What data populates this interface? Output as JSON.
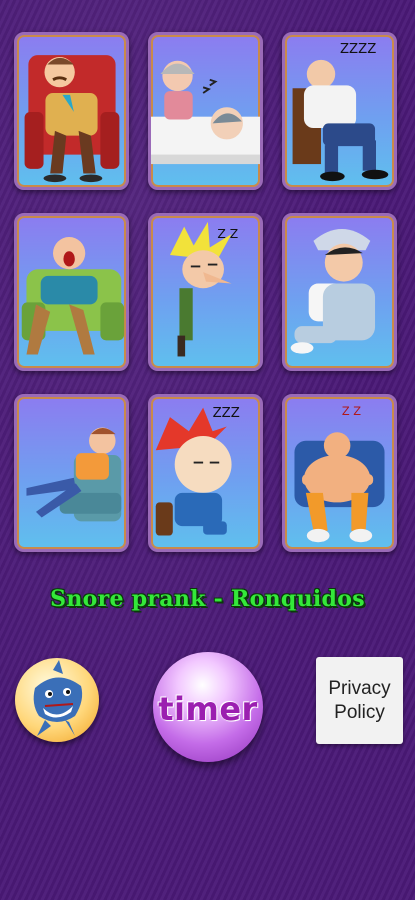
{
  "app": {
    "title": "Snore prank - Ronquidos"
  },
  "cards": [
    {
      "name": "card-old-man-armchair",
      "icon": "sleeping-old-man-armchair"
    },
    {
      "name": "card-grandma-bed",
      "icon": "grandma-and-sleeper-in-bed"
    },
    {
      "name": "card-man-chair",
      "icon": "snoring-man-chair"
    },
    {
      "name": "card-man-sofa",
      "icon": "yawning-man-sofa"
    },
    {
      "name": "card-blond-guy",
      "icon": "sleepy-blond-guy"
    },
    {
      "name": "card-boy-pillow",
      "icon": "boy-with-pillow"
    },
    {
      "name": "card-man-recliner",
      "icon": "man-recliner"
    },
    {
      "name": "card-redhead-boy",
      "icon": "sleepy-redhead-boy"
    },
    {
      "name": "card-baby-armchair",
      "icon": "baby-in-armchair"
    }
  ],
  "buttons": {
    "timer_label": "timer",
    "privacy_label": "Privacy\nPolicy",
    "shark_icon": "shark-icon"
  },
  "colors": {
    "background": "#4b1a78",
    "title": "#34e83a",
    "timer_text": "#9b1fb0"
  }
}
